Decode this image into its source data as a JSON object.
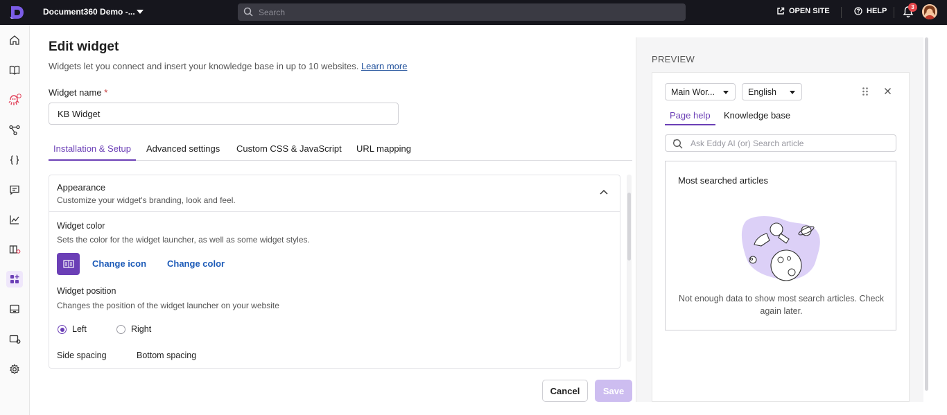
{
  "topbar": {
    "project": "Document360 Demo -...",
    "search_placeholder": "Search",
    "open_site": "OPEN SITE",
    "help": "HELP",
    "notification_count": "3"
  },
  "page": {
    "title": "Edit widget",
    "subtitle": "Widgets let you connect and insert your knowledge base in up to 10 websites.",
    "learn_more": "Learn more"
  },
  "form": {
    "widget_name_label": "Widget name",
    "required_marker": "*",
    "widget_name_value": "KB Widget"
  },
  "tabs": [
    "Installation & Setup",
    "Advanced settings",
    "Custom CSS & JavaScript",
    "URL mapping"
  ],
  "appearance": {
    "title": "Appearance",
    "subtitle": "Customize your widget's branding, look and feel.",
    "widget_color_label": "Widget color",
    "widget_color_desc": "Sets the color for the widget launcher, as well as some widget styles.",
    "change_icon": "Change icon",
    "change_color": "Change color",
    "widget_color": "#6b3fb6",
    "widget_position_label": "Widget position",
    "widget_position_desc": "Changes the position of the widget launcher on your website",
    "position_left": "Left",
    "position_right": "Right",
    "selected_position": "Left",
    "side_spacing": "Side spacing",
    "bottom_spacing": "Bottom spacing"
  },
  "actions": {
    "cancel": "Cancel",
    "save": "Save"
  },
  "preview": {
    "label": "PREVIEW",
    "workspace": "Main Wor...",
    "language": "English",
    "tabs": [
      "Page help",
      "Knowledge base"
    ],
    "search_placeholder": "Ask Eddy AI (or) Search article",
    "most_searched_title": "Most searched articles",
    "empty_message": "Not enough data to show most search articles. Check again later."
  }
}
